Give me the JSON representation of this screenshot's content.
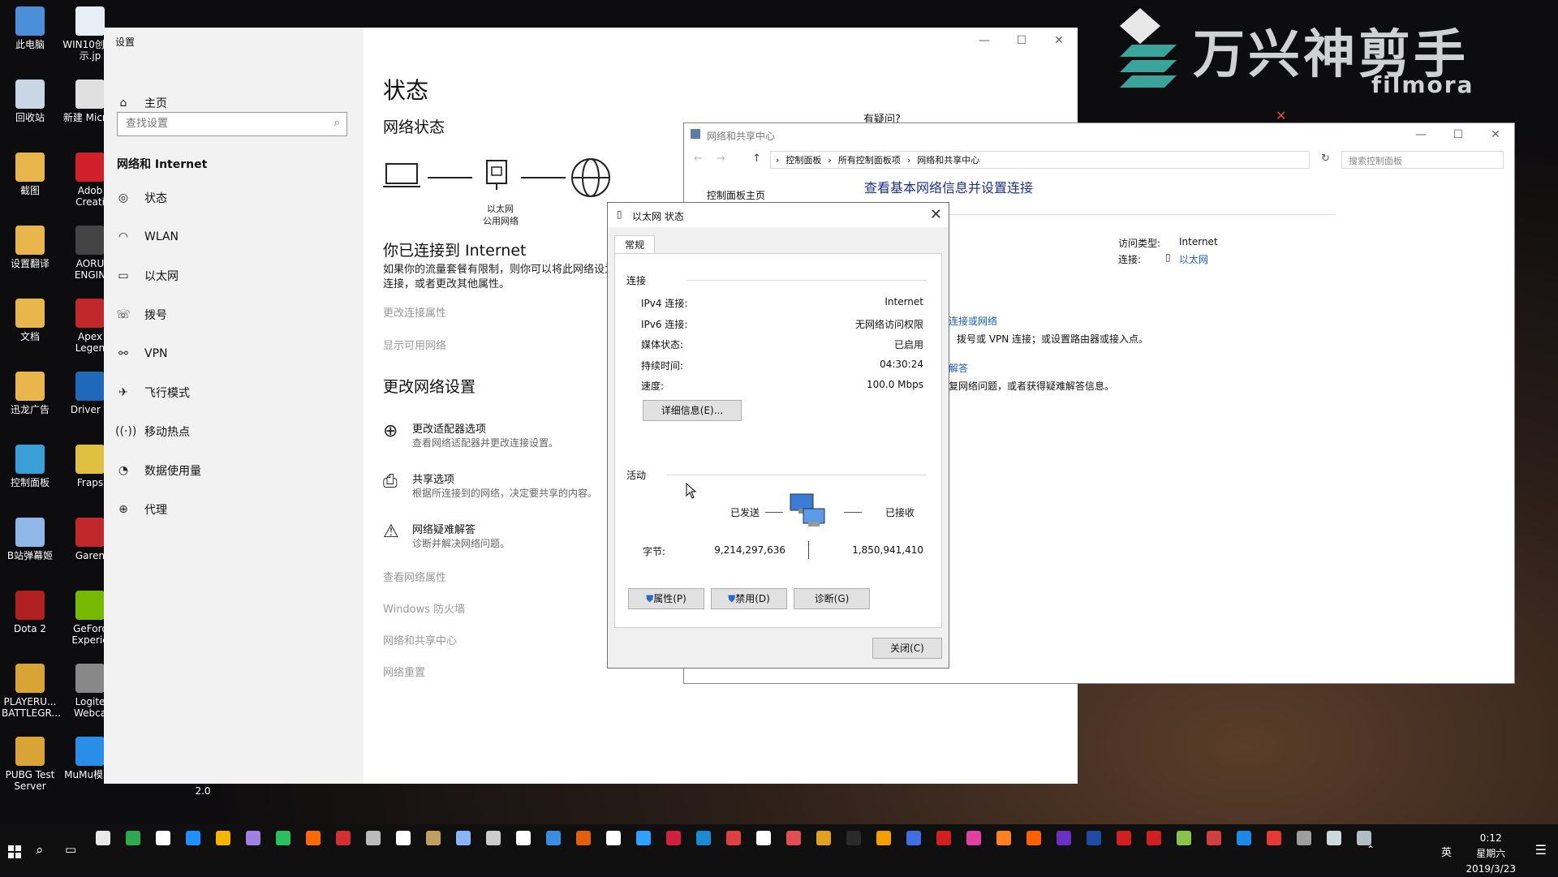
{
  "desktop": {
    "icons_col1": [
      "此电脑",
      "回收站",
      "截图",
      "设置翻译",
      "文档",
      "迅龙广告",
      "控制面板",
      "B站弹幕姬",
      "Dota 2",
      "PLAYERU... BATTLEGR...",
      "PUBG Test Server"
    ],
    "icons_col2": [
      "WIN10创 演示.jp",
      "新建 Micros",
      "Adob Creati",
      "AORU ENGIN",
      "Apex Legen",
      "Driver E",
      "Fraps",
      "Garen",
      "GeForc Experie",
      "Logite Webca",
      "MuMu模 器"
    ],
    "version_text": "2.0"
  },
  "watermark": {
    "cn": "万兴神剪手",
    "en": "filmora"
  },
  "settings": {
    "title": "设置",
    "nav_home": "主页",
    "search_placeholder": "查找设置",
    "section": "网络和 Internet",
    "nav": [
      "状态",
      "WLAN",
      "以太网",
      "拨号",
      "VPN",
      "飞行模式",
      "移动热点",
      "数据使用量",
      "代理"
    ],
    "page_title": "状态",
    "network_status": "网络状态",
    "diagram_label1": "以太网",
    "diagram_label2": "公用网络",
    "connected": "你已连接到 Internet",
    "connected_desc": "如果你的流量套餐有限制，则你可以将此网络设为按流量计费的",
    "connected_desc2": "连接，或者更改其他属性。",
    "link_props": "更改连接属性",
    "link_available": "显示可用网络",
    "change_settings": "更改网络设置",
    "opt1_title": "更改适配器选项",
    "opt1_desc": "查看网络适配器并更改连接设置。",
    "opt2_title": "共享选项",
    "opt2_desc": "根据所连接到的网络，决定要共享的内容。",
    "opt3_title": "网络疑难解答",
    "opt3_desc": "诊断并解决网络问题。",
    "link_view_props": "查看网络属性",
    "link_firewall": "Windows 防火墙",
    "link_center": "网络和共享中心",
    "link_reset": "网络重置",
    "question": "有疑问?"
  },
  "nsc": {
    "title": "网络和共享中心",
    "breadcrumb": [
      "控制面板",
      "所有控制面板项",
      "网络和共享中心"
    ],
    "search_placeholder": "搜索控制面板",
    "side_home": "控制面板主页",
    "heading": "查看基本网络信息并设置连接",
    "access_label": "访问类型:",
    "access_value": "Internet",
    "conn_label": "连接:",
    "conn_value": "以太网",
    "link1": "连接或网络",
    "text1": "拨号或 VPN 连接；或设置路由器或接入点。",
    "link2": "解答",
    "text2": "复网络问题，或者获得疑难解答信息。"
  },
  "dialog": {
    "title": "以太网 状态",
    "tab": "常规",
    "group_conn": "连接",
    "rows": [
      {
        "label": "IPv4 连接:",
        "value": "Internet"
      },
      {
        "label": "IPv6 连接:",
        "value": "无网络访问权限"
      },
      {
        "label": "媒体状态:",
        "value": "已启用"
      },
      {
        "label": "持续时间:",
        "value": "04:30:24"
      },
      {
        "label": "速度:",
        "value": "100.0 Mbps"
      }
    ],
    "details_btn": "详细信息(E)...",
    "group_activity": "活动",
    "sent_label": "已发送",
    "recv_label": "已接收",
    "bytes_label": "字节:",
    "bytes_sent": "9,214,297,636",
    "bytes_recv": "1,850,941,410",
    "btn_props": "属性(P)",
    "btn_disable": "禁用(D)",
    "btn_diagnose": "诊断(G)",
    "btn_close": "关闭(C)"
  },
  "taskbar": {
    "time": "0:12",
    "weekday": "星期六",
    "date": "2019/3/23",
    "ime": "英"
  }
}
